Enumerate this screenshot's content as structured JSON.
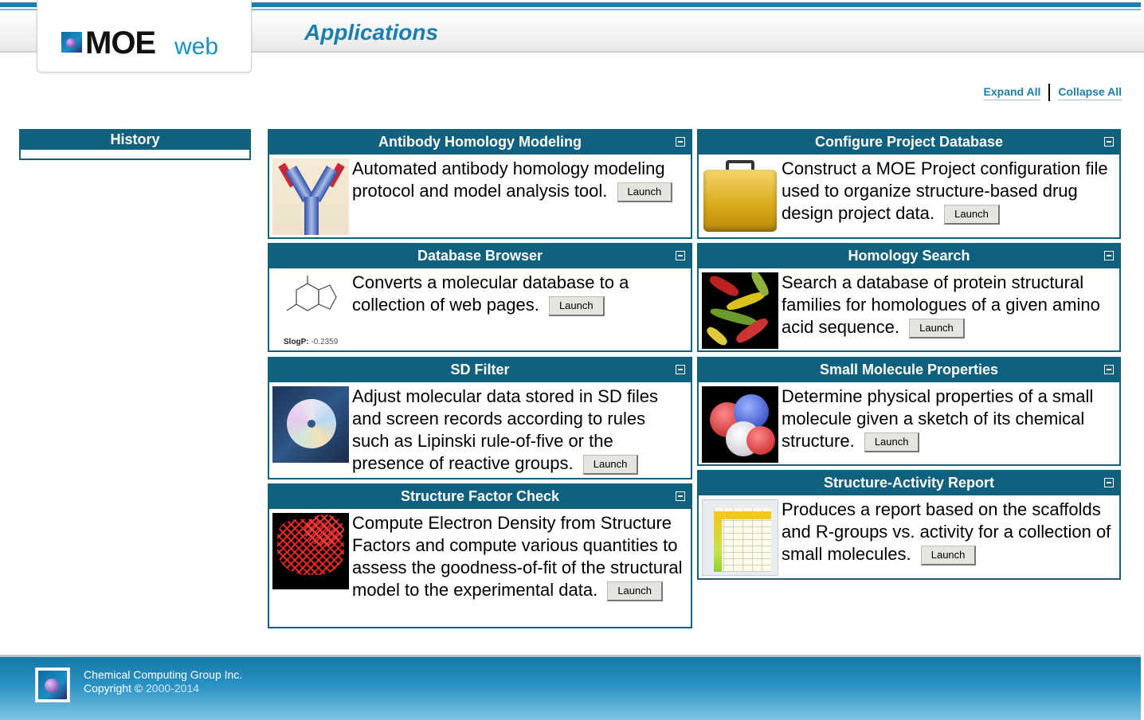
{
  "header": {
    "logo_moe": "MOE",
    "logo_web": "web",
    "page_title": "Applications"
  },
  "controls": {
    "expand_all": "Expand All",
    "collapse_all": "Collapse All"
  },
  "history": {
    "title": "History"
  },
  "panels": [
    {
      "title": "Antibody Homology Modeling",
      "description": "Automated antibody homology modeling protocol and model analysis tool.",
      "launch": "Launch",
      "thumbnail": "antibody-structure-image"
    },
    {
      "title": "Configure Project Database",
      "description": "Construct a MOE Project configuration file used to organize structure-based drug design project data.",
      "launch": "Launch",
      "thumbnail": "briefcase-image"
    },
    {
      "title": "Database Browser",
      "description": "Converts a molecular database to a collection of web pages.",
      "launch": "Launch",
      "thumbnail": "molecule-sketch-image",
      "thumb_caption_label": "SlogP:",
      "thumb_caption_value": "-0.2359"
    },
    {
      "title": "Homology Search",
      "description": "Search a database of protein structural families for homologues of a given amino acid sequence.",
      "launch": "Launch",
      "thumbnail": "protein-ribbon-image"
    },
    {
      "title": "SD Filter",
      "description": "Adjust molecular data stored in SD files and screen records according to rules such as Lipinski rule-of-five or the presence of reactive groups.",
      "launch": "Launch",
      "thumbnail": "cd-disc-image"
    },
    {
      "title": "Small Molecule Properties",
      "description": "Determine physical properties of a small molecule given a sketch of its chemical structure.",
      "launch": "Launch",
      "thumbnail": "molecular-surface-image"
    },
    {
      "title": "Structure Factor Check",
      "description": "Compute Electron Density from Structure Factors and compute various quantities to assess the goodness-of-fit of the structural model to the experimental data.",
      "launch": "Launch",
      "thumbnail": "electron-density-mesh-image"
    },
    {
      "title": "Structure-Activity Report",
      "description": "Produces a report based on the scaffolds and R-groups vs. activity for a collection of small molecules.",
      "launch": "Launch",
      "thumbnail": "report-table-image"
    }
  ],
  "footer": {
    "company": "Chemical Computing Group Inc.",
    "copyright_label": "Copyright ©",
    "copyright_years": "2000-2014"
  },
  "colors": {
    "panel_header": "#10607e",
    "accent_blue": "#1a7fae",
    "footer_blue": "#2a93c4"
  }
}
